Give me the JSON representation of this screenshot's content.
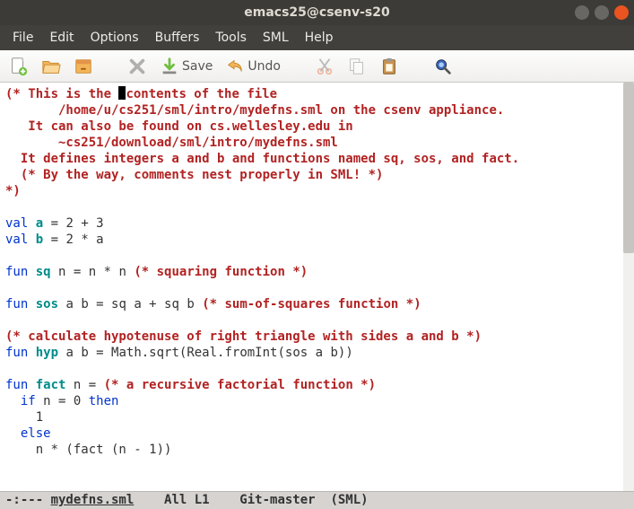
{
  "window": {
    "title": "emacs25@csenv-s20"
  },
  "menu": {
    "items": [
      "File",
      "Edit",
      "Options",
      "Buffers",
      "Tools",
      "SML",
      "Help"
    ]
  },
  "toolbar": {
    "newfile_label": "",
    "open_label": "",
    "dir_label": "",
    "close_label": "",
    "save_label": "Save",
    "undo_label": "Undo",
    "cut_label": "",
    "copy_label": "",
    "paste_label": "",
    "search_label": ""
  },
  "code": {
    "c1": "(* This is the",
    "c1b": "contents of the file",
    "c2": "       /home/u/cs251/sml/intro/mydefns.sml on the csenv appliance.",
    "c3": "   It can also be found on cs.wellesley.edu in",
    "c4": "       ~cs251/download/sml/intro/mydefns.sml",
    "c5": "  It defines integers a and b and functions named sq, sos, and fact.",
    "c6": "  (* By the way, comments nest properly in SML! *)",
    "c7": "*)",
    "l_val": "val",
    "l_fun": "fun",
    "l_if": "if",
    "l_then": "then",
    "l_else": "else",
    "a_name": "a",
    "a_rhs": " = 2 + 3",
    "b_name": "b",
    "b_rhs": " = 2 * a",
    "sq_name": "sq",
    "sq_rhs": " n = n * n ",
    "sq_cmt": "(* squaring function *)",
    "sos_name": "sos",
    "sos_rhs": " a b = sq a + sq b ",
    "sos_cmt": "(* sum-of-squares function *)",
    "hyp_cmt": "(* calculate hypotenuse of right triangle with sides a and b *)",
    "hyp_name": "hyp",
    "hyp_rhs": " a b = Math.sqrt(Real.fromInt(sos a b))",
    "fact_name": "fact",
    "fact_head": " n = ",
    "fact_cmt": "(* a recursive factorial function *)",
    "fact_cond": " n = 0 ",
    "fact_one": "    1",
    "fact_rec": "    n * (fact (n - 1))"
  },
  "modeline": {
    "left": "-:--- ",
    "file": "mydefns.sml",
    "mid1": "    All L1    Git-master  (SML)"
  }
}
